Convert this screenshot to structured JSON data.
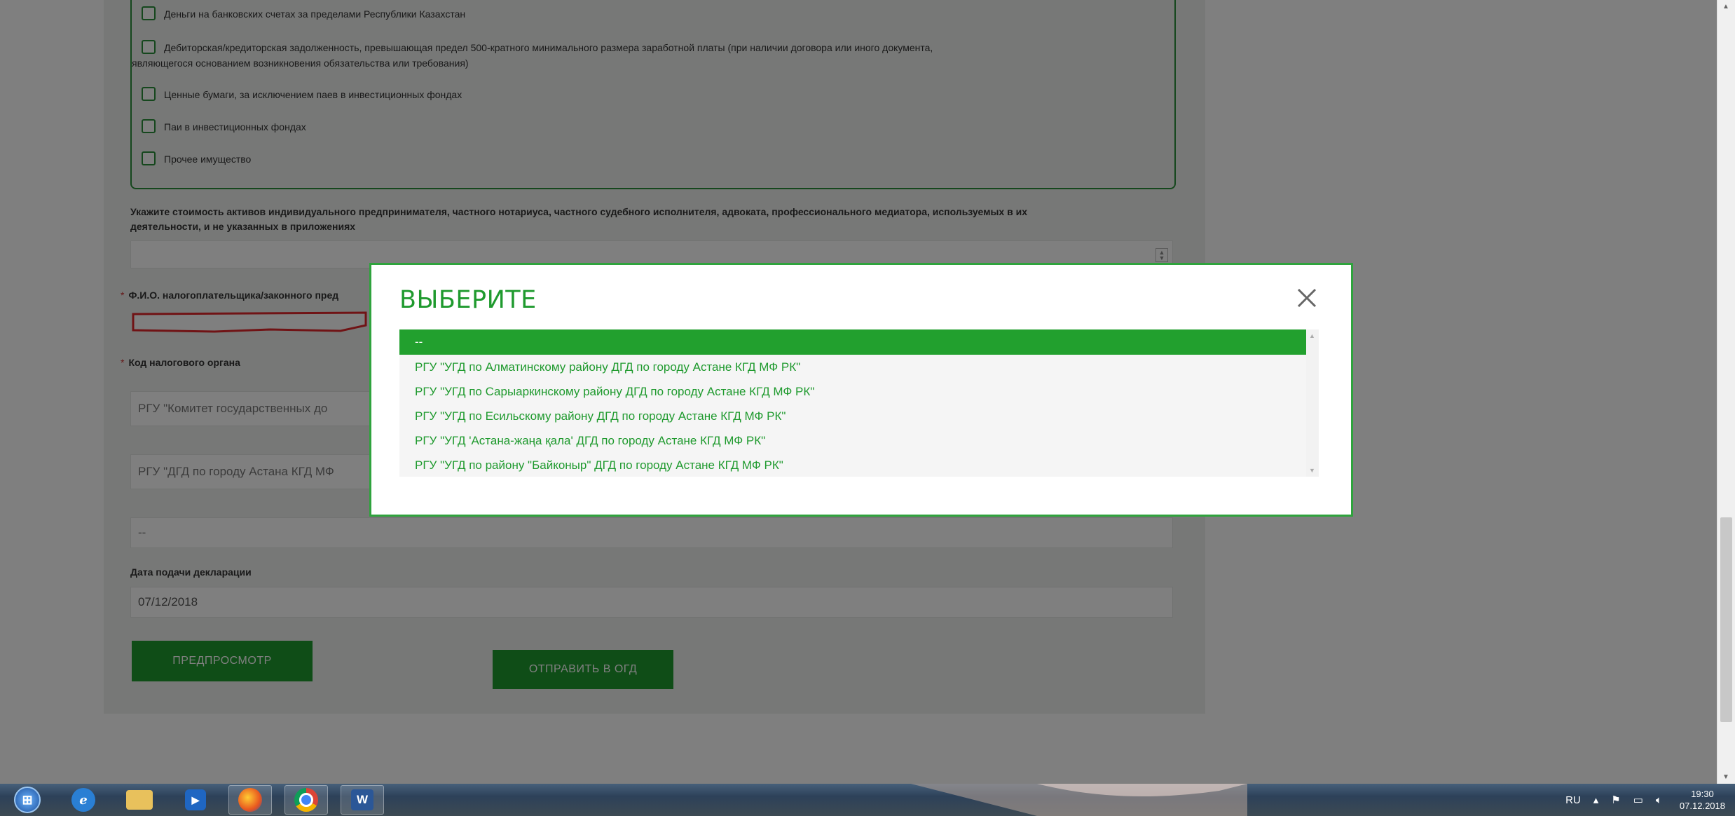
{
  "form": {
    "assets_options": [
      "Деньги на банковских счетах за пределами Республики Казахстан",
      "Дебиторская/кредиторская задолженность, превышающая предел 500-кратного минимального размера заработной платы (при наличии договора или иного документа,",
      "являющегося основанием возникновения обязательства или требования)",
      "Ценные бумаги, за исключением паев в инвестиционных фондах",
      "Паи в инвестиционных фондах",
      "Прочее имущество"
    ],
    "assets_value_label_line1": "Укажите стоимость активов индивидуального предпринимателя, частного нотариуса, частного судебного исполнителя, адвоката, профессионального медиатора, используемых в их",
    "assets_value_label_line2": "деятельности, и не указанных в приложениях",
    "required_mark": "*",
    "fio_label": "Ф.И.О. налогоплательщика/законного пред",
    "tax_org_label": "Код налогового органа",
    "tax_org_field1": "РГУ \"Комитет государственных до",
    "tax_org_field2": "РГУ \"ДГД по городу Астана КГД МФ",
    "tax_org_field3": "--",
    "date_label": "Дата подачи декларации",
    "date_value": "07/12/2018",
    "preview_button": "ПРЕДПРОСМОТР",
    "send_button": "ОТПРАВИТЬ В ОГД"
  },
  "modal": {
    "title": "ВЫБЕРИТЕ",
    "close_icon": "close-icon",
    "options": [
      "--",
      "РГУ \"УГД по Алматинскому району ДГД по городу Астане КГД МФ РК\"",
      "РГУ \"УГД по Сарыаркинскому району ДГД по городу Астане КГД МФ РК\"",
      "РГУ \"УГД по Есильскому району ДГД по городу Астане КГД МФ РК\"",
      "РГУ \"УГД 'Астана-жаңа қала' ДГД по городу Астане КГД МФ РК\"",
      "РГУ \"УГД по району \"Байконыр\" ДГД по городу Астане КГД МФ РК\""
    ],
    "selected_index": 0
  },
  "taskbar": {
    "apps": [
      "start-orb-icon",
      "internet-explorer-icon",
      "file-explorer-icon",
      "media-player-icon",
      "firefox-icon",
      "chrome-icon",
      "word-icon"
    ],
    "language": "RU",
    "time": "19:30",
    "date": "07.12.2018"
  },
  "colors": {
    "accent_green": "#1f9a2e",
    "overlay": "rgba(0,0,0,0.5)"
  }
}
